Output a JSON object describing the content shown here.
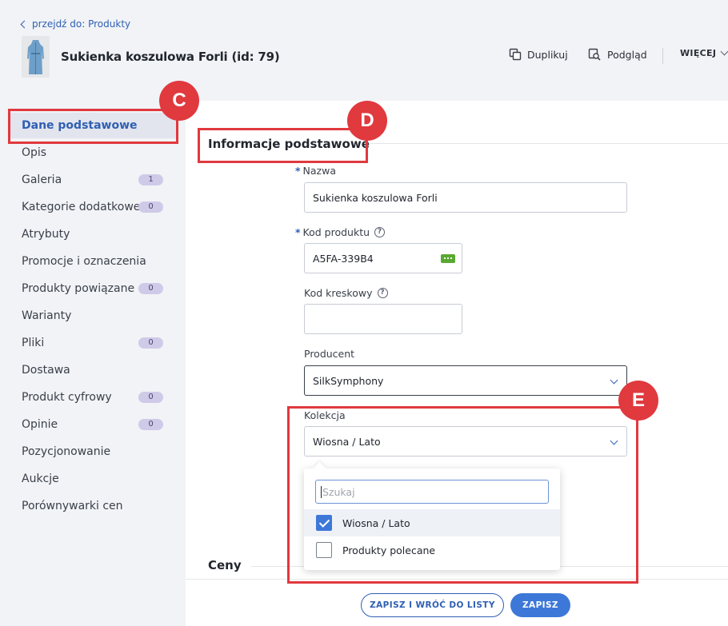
{
  "header": {
    "back_link": "przejdź do: Produkty",
    "product_title": "Sukienka koszulowa Forli (id: 79)",
    "actions": {
      "duplicate": "Duplikuj",
      "preview": "Podgląd",
      "more": "WIĘCEJ"
    }
  },
  "sidebar": {
    "items": [
      {
        "label": "Dane podstawowe",
        "badge": null,
        "active": true
      },
      {
        "label": "Opis",
        "badge": null
      },
      {
        "label": "Galeria",
        "badge": "1"
      },
      {
        "label": "Kategorie dodatkowe",
        "badge": "0"
      },
      {
        "label": "Atrybuty",
        "badge": null
      },
      {
        "label": "Promocje i oznaczenia",
        "badge": null
      },
      {
        "label": "Produkty powiązane",
        "badge": "0"
      },
      {
        "label": "Warianty",
        "badge": null
      },
      {
        "label": "Pliki",
        "badge": "0"
      },
      {
        "label": "Dostawa",
        "badge": null
      },
      {
        "label": "Produkt cyfrowy",
        "badge": "0"
      },
      {
        "label": "Opinie",
        "badge": "0"
      },
      {
        "label": "Pozycjonowanie",
        "badge": null
      },
      {
        "label": "Aukcje",
        "badge": null
      },
      {
        "label": "Porównywarki cen",
        "badge": null
      }
    ]
  },
  "main": {
    "section_title": "Informacje podstawowe",
    "section2_title": "Ceny",
    "fields": {
      "name": {
        "label": "Nazwa",
        "value": "Sukienka koszulowa Forli"
      },
      "product_code": {
        "label": "Kod produktu",
        "value": "A5FA-339B4"
      },
      "barcode": {
        "label": "Kod kreskowy",
        "value": ""
      },
      "producer": {
        "label": "Producent",
        "value": "SilkSymphony"
      },
      "collection": {
        "label": "Kolekcja",
        "value": "Wiosna / Lato"
      }
    },
    "dropdown": {
      "search_placeholder": "Szukaj",
      "options": [
        {
          "label": "Wiosna / Lato",
          "checked": true
        },
        {
          "label": "Produkty polecane",
          "checked": false
        }
      ]
    }
  },
  "footer": {
    "save_and_back": "ZAPISZ I WRÓĆ DO LISTY",
    "save": "ZAPISZ"
  },
  "annotations": {
    "c": "C",
    "d": "D",
    "e": "E"
  },
  "colors": {
    "accent": "#3d78d8",
    "highlight": "#e0393e",
    "badge": "#cfcae8",
    "code_button": "#5aa832"
  }
}
